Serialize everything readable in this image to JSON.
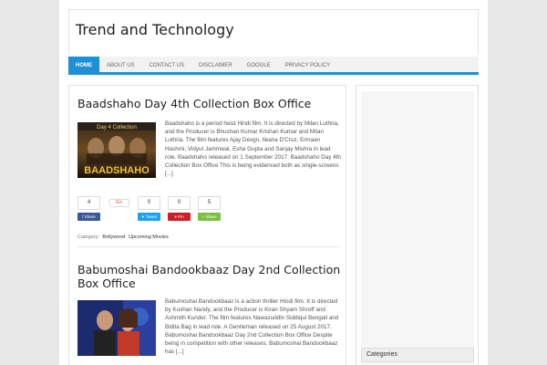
{
  "site": {
    "title": "Trend and Technology"
  },
  "nav": [
    "HOME",
    "ABOUT US",
    "CONTACT US",
    "DISCLAIMER",
    "GOOGLE",
    "PRIVACY POLICY"
  ],
  "colors": {
    "accent": "#1e90d6",
    "facebook": "#3b5998",
    "twitter": "#1da1f2",
    "pinterest": "#cb2027",
    "share": "#7ac143"
  },
  "posts": [
    {
      "title": "Baadshaho Day 4th Collection Box Office",
      "thumb_text": "BAADSHAHO",
      "thumb_top": "Day 4 Collection",
      "excerpt": "Baadshaho is a  period heist Hindi film. It is directed by Milan Luthria, and the Producer is Bhushan Kumar Krishan Kumar and Milan Luthria. The film features Ajay Devgn, Ileana D'Cruz, Emraan Hashmi, Vidyut Jammwal, Esha Gupta and Sanjay Mishra in lead role. Baadshaho released on 1 September 2017. Baadshaho Day 4th Collection Box Office This is being evidenced both as single-screens [...]",
      "shares": [
        {
          "count": "4",
          "label": "Share",
          "icon": "facebook-icon"
        },
        {
          "count": "G+",
          "label": "",
          "icon": "google-plus-icon"
        },
        {
          "count": "0",
          "label": "Tweet",
          "icon": "twitter-icon"
        },
        {
          "count": "0",
          "label": "Pin",
          "icon": "pinterest-icon"
        },
        {
          "count": "5",
          "label": "Share",
          "icon": "share-icon"
        }
      ],
      "category_label": "Category:",
      "categories": [
        "Bollywood",
        "Upcoming Movies"
      ]
    },
    {
      "title": "Babumoshai Bandookbaaz Day 2nd Collection Box Office",
      "excerpt": "Babumoshai Bandookbaaz is a  action thriller Hindi film. It is directed by Kushan Nandy, and the Producer is Kiran Shyam Shroff and Ashmith Kunder. The film features  Nawazuddin Siddiqui  Bengali and Bidita Bag in lead role. A Gentleman released on 25 August 2017. Babumoshai Bandookbaaz Day 2nd Collection Box Office Despite being in competition with other releases, Babumoshai Bandookbaaz has [...]"
    }
  ],
  "sidebar": {
    "widget_title": "Categories"
  }
}
